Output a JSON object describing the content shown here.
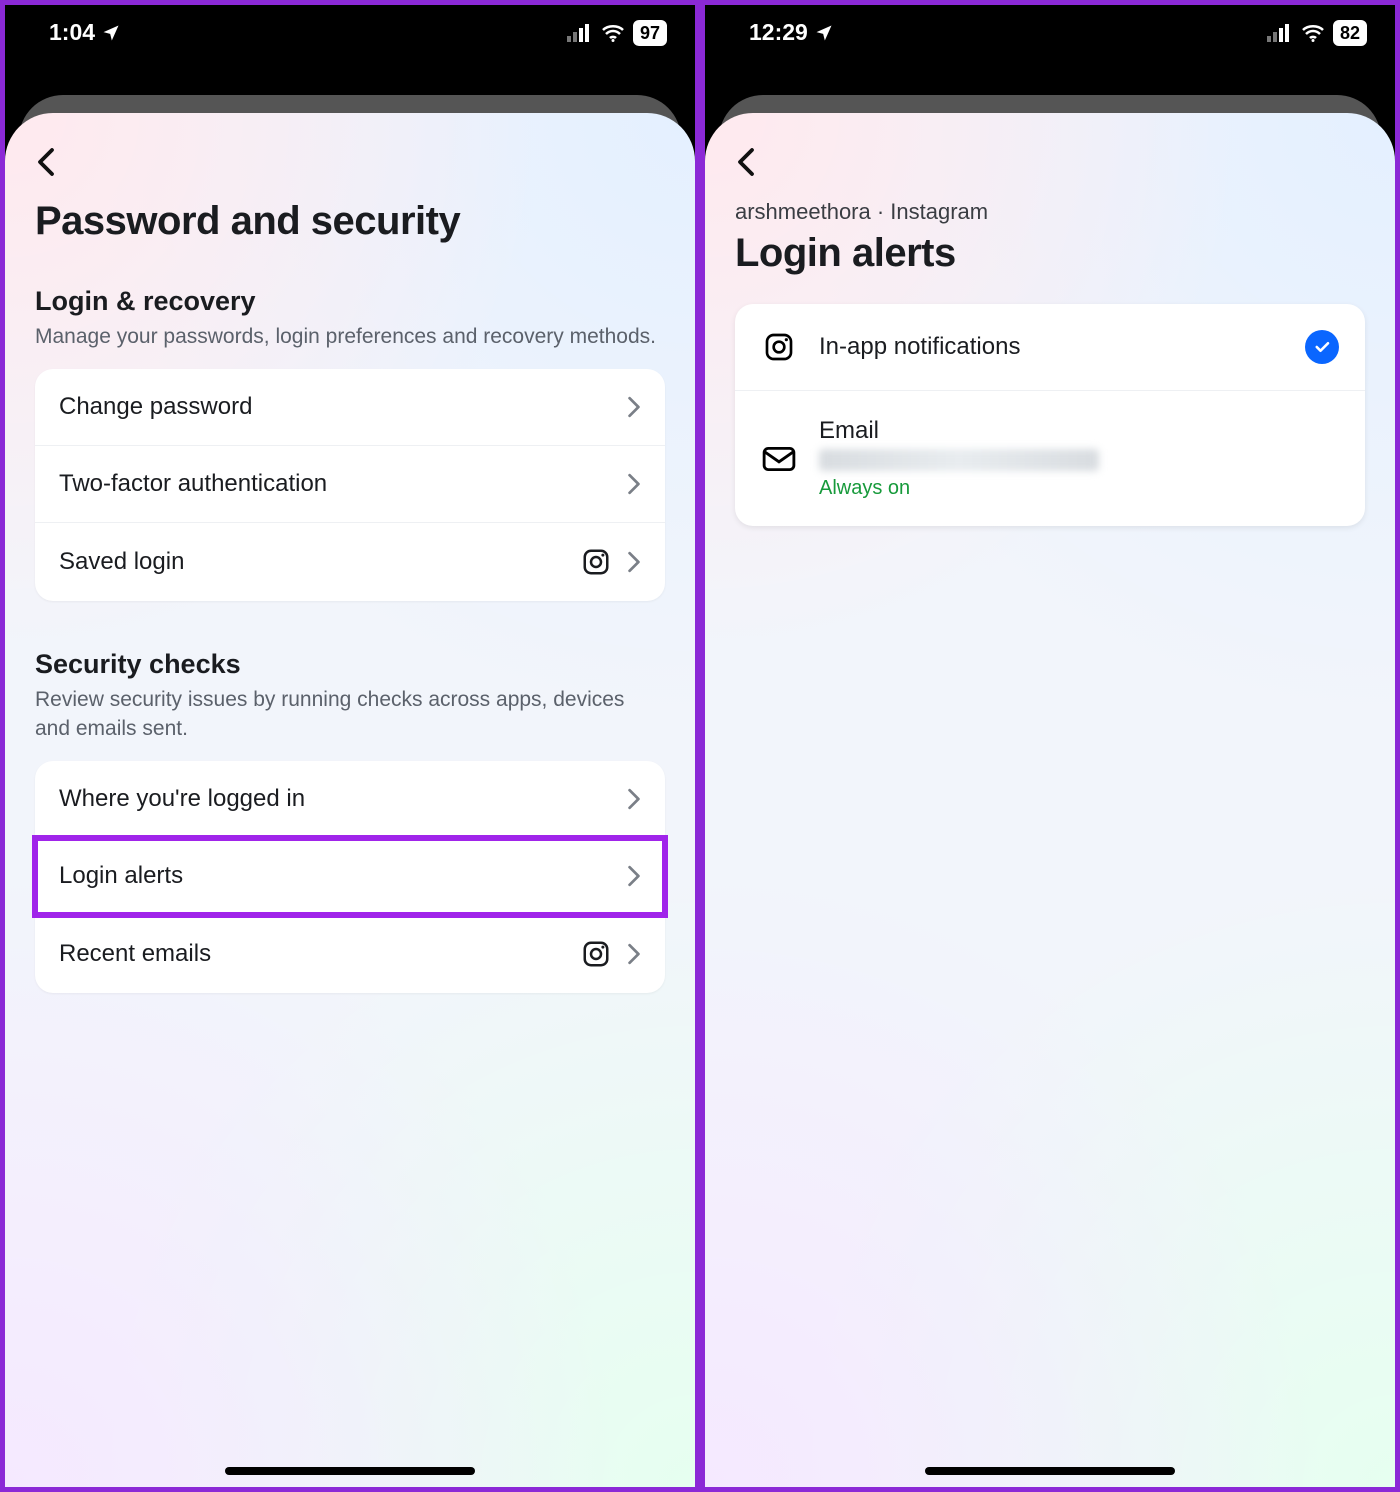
{
  "left": {
    "statusbar": {
      "time": "1:04",
      "battery": "97"
    },
    "title": "Password and security",
    "sections": [
      {
        "heading": "Login & recovery",
        "description": "Manage your passwords, login preferences and recovery methods.",
        "rows": [
          {
            "label": "Change password",
            "instagram_icon": false,
            "highlight": false
          },
          {
            "label": "Two-factor authentication",
            "instagram_icon": false,
            "highlight": false
          },
          {
            "label": "Saved login",
            "instagram_icon": true,
            "highlight": false
          }
        ]
      },
      {
        "heading": "Security checks",
        "description": "Review security issues by running checks across apps, devices and emails sent.",
        "rows": [
          {
            "label": "Where you're logged in",
            "instagram_icon": false,
            "highlight": false
          },
          {
            "label": "Login alerts",
            "instagram_icon": false,
            "highlight": true
          },
          {
            "label": "Recent emails",
            "instagram_icon": true,
            "highlight": false
          }
        ]
      }
    ]
  },
  "right": {
    "statusbar": {
      "time": "12:29",
      "battery": "82"
    },
    "breadcrumb": "arshmeethora · Instagram",
    "title": "Login alerts",
    "rows": [
      {
        "icon": "instagram",
        "title": "In-app notifications",
        "checked": true
      },
      {
        "icon": "email",
        "title": "Email",
        "redacted": true,
        "status": "Always on"
      }
    ]
  },
  "icons": {
    "instagram": "instagram-icon",
    "email": "email-icon",
    "chevron": "chevron-right-icon",
    "back": "chevron-left-icon",
    "location": "location-arrow-icon",
    "signal": "cellular-signal-icon",
    "wifi": "wifi-icon",
    "check": "check-icon"
  }
}
